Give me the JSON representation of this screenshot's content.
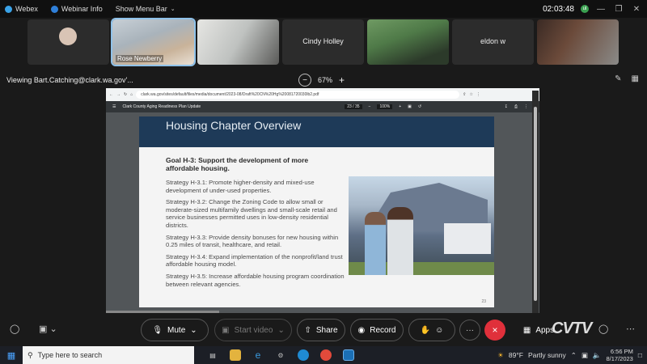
{
  "titlebar": {
    "app_name": "Webex",
    "webinar_info": "Webinar Info",
    "show_menu_bar": "Show Menu Bar",
    "timer": "02:03:48",
    "status_badge": "ul"
  },
  "participants": [
    {
      "name": "",
      "kind": "avatar"
    },
    {
      "name": "Rose Newberry",
      "kind": "video",
      "active": true
    },
    {
      "name": "",
      "kind": "video"
    },
    {
      "name": "Cindy Holley",
      "kind": "name-only"
    },
    {
      "name": "",
      "kind": "video"
    },
    {
      "name": "eldon w",
      "kind": "name-only"
    },
    {
      "name": "",
      "kind": "video"
    }
  ],
  "viewbar": {
    "viewing": "Viewing Bart.Catching@clark.wa.gov'...",
    "zoom": "67%",
    "zoom_out": "−",
    "zoom_in": "+"
  },
  "browser": {
    "url": "clark.wa.gov/sites/default/files/media/document/2023-08/Draft%20CN%20Hg%20081720030lb2.pdf",
    "pdf_title": "Clark County Aging Readiness Plan Update",
    "page": "23 / 35",
    "pdf_zoom": "100%"
  },
  "slide": {
    "title": "Housing Chapter Overview",
    "goal": "Goal H-3: Support the development of more affordable housing.",
    "strategies": [
      "Strategy H-3.1: Promote higher-density and mixed-use development of under-used properties.",
      "Strategy H-3.2: Change the Zoning Code to allow small or moderate-sized multifamily dwellings and small-scale retail and service businesses permitted uses in low-density residential districts.",
      "Strategy H-3.3: Provide density bonuses for new housing within 0.25 miles of transit, healthcare, and retail.",
      "Strategy H-3.4: Expand implementation of the nonprofit/land trust affordable housing model.",
      "Strategy H-3.5: Increase affordable housing program coordination between relevant agencies."
    ],
    "page_number": "23"
  },
  "controls": {
    "mute": "Mute",
    "start_video": "Start video",
    "share": "Share",
    "record": "Record",
    "more": "···",
    "end": "×",
    "apps": "Apps"
  },
  "watermark": "CVTV",
  "taskbar": {
    "search_placeholder": "Type here to search",
    "weather_temp": "89°F",
    "weather_desc": "Partly sunny",
    "time": "6:56 PM",
    "date": "8/17/2023"
  },
  "colors": {
    "accent": "#8fc2ea",
    "end_button": "#e0303b",
    "slide_header": "#1e3a58"
  }
}
